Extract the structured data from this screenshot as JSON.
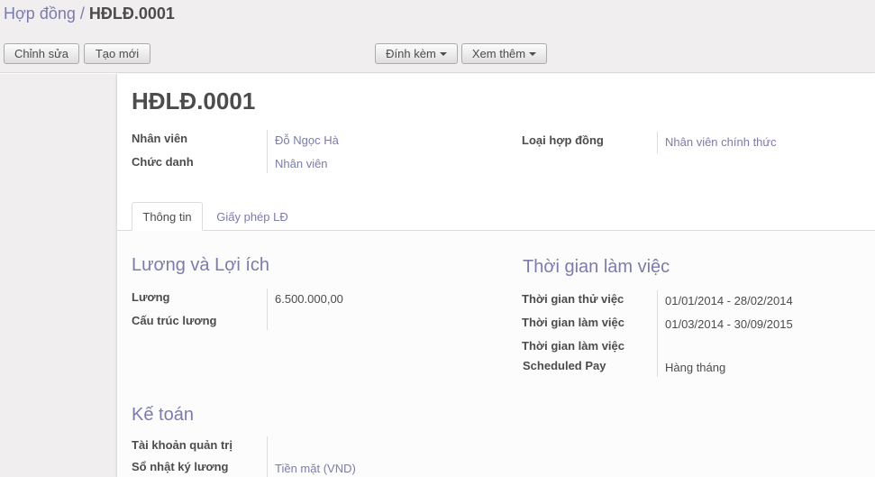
{
  "breadcrumb": {
    "parent": "Hợp đồng",
    "separator": "/",
    "current": "HĐLĐ.0001"
  },
  "toolbar": {
    "edit_label": "Chỉnh sửa",
    "create_label": "Tạo mới",
    "attach_label": "Đính kèm",
    "more_label": "Xem thêm"
  },
  "record": {
    "title": "HĐLĐ.0001",
    "employee_label": "Nhân viên",
    "employee_value": "Đỗ Ngọc Hà",
    "job_label": "Chức danh",
    "job_value": "Nhân viên",
    "type_label": "Loại hợp đồng",
    "type_value": "Nhân viên chính thức"
  },
  "tabs": [
    {
      "label": "Thông tin"
    },
    {
      "label": "Giấy phép LĐ"
    }
  ],
  "salary": {
    "heading": "Lương và Lợi ích",
    "wage_label": "Lương",
    "wage_value": "6.500.000,00",
    "structure_label": "Cấu trúc lương",
    "structure_value": ""
  },
  "duration": {
    "heading": "Thời gian làm việc",
    "trial_label": "Thời gian thử việc",
    "trial_value": "01/01/2014 - 28/02/2014",
    "work_label": "Thời gian làm việc",
    "work_value": "01/03/2014 - 30/09/2015",
    "work2_label": "Thời gian làm việc",
    "work2_value": "",
    "pay_label": "Scheduled Pay",
    "pay_value": "Hàng tháng"
  },
  "accounting": {
    "heading": "Kế toán",
    "account_label": "Tài khoản quản trị",
    "account_value": "",
    "journal_label": "Sổ nhật ký lương",
    "journal_value": "Tiền mặt (VND)"
  }
}
